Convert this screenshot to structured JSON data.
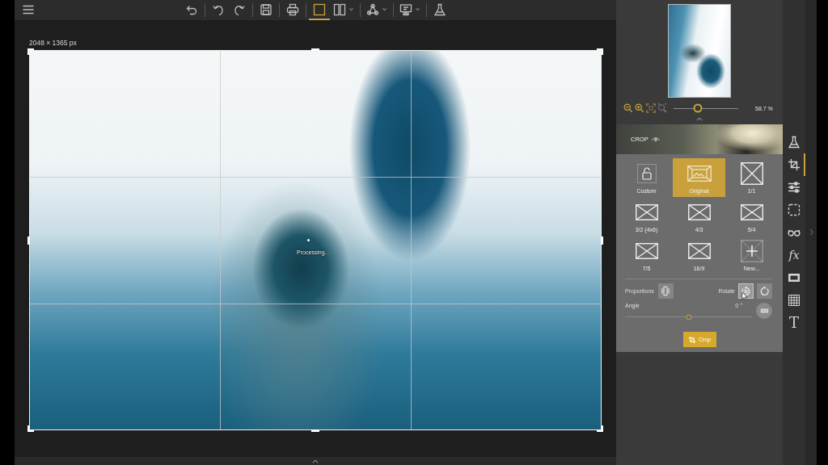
{
  "toolbar": {
    "buttons": [
      {
        "selected": false,
        "menu": false
      },
      {
        "selected": false,
        "menu": false
      },
      {
        "selected": false,
        "menu": false
      },
      {
        "selected": false,
        "menu": false
      },
      {
        "selected": false,
        "menu": false
      },
      {
        "selected": true,
        "menu": false
      },
      {
        "selected": false,
        "menu": true
      },
      {
        "selected": false,
        "menu": true
      },
      {
        "selected": false,
        "menu": true
      },
      {
        "selected": false,
        "menu": false
      }
    ]
  },
  "canvas": {
    "image_size": "2048 × 1365 px",
    "status": "Processing..."
  },
  "navigator": {
    "zoom": {
      "level": 0.38
    },
    "zoom_value": "58.7 %"
  },
  "crop_panel": {
    "title": "CROP",
    "presets": [
      {
        "label": "Custom",
        "kind": "custom",
        "selected": false
      },
      {
        "label": "Original",
        "kind": "original",
        "selected": true
      },
      {
        "label": "1/1",
        "kind": "square",
        "selected": false
      },
      {
        "label": "3/2 (4x6)",
        "kind": "ratio",
        "selected": false
      },
      {
        "label": "4/3",
        "kind": "ratio",
        "selected": false
      },
      {
        "label": "5/4",
        "kind": "ratio",
        "selected": false
      },
      {
        "label": "7/5",
        "kind": "ratio",
        "selected": false
      },
      {
        "label": "16/9",
        "kind": "ratio",
        "selected": false
      },
      {
        "label": "New...",
        "kind": "add",
        "selected": false
      }
    ],
    "proportions_label": "Proportions",
    "rotate_label": "Rotate",
    "rotate_buttons": [
      {
        "hovered": true
      },
      {
        "hovered": false
      }
    ],
    "angle_label": "Angle",
    "angle_value": "0 °",
    "angle": {
      "level": 0.5
    },
    "crop_button": "Crop"
  },
  "tools": [
    {
      "selected": false
    },
    {
      "selected": true
    },
    {
      "selected": false
    },
    {
      "selected": false
    },
    {
      "selected": false
    },
    {
      "glyph": "fx",
      "selected": false
    },
    {
      "selected": false
    },
    {
      "selected": false
    },
    {
      "glyph": "T",
      "selected": false
    }
  ]
}
